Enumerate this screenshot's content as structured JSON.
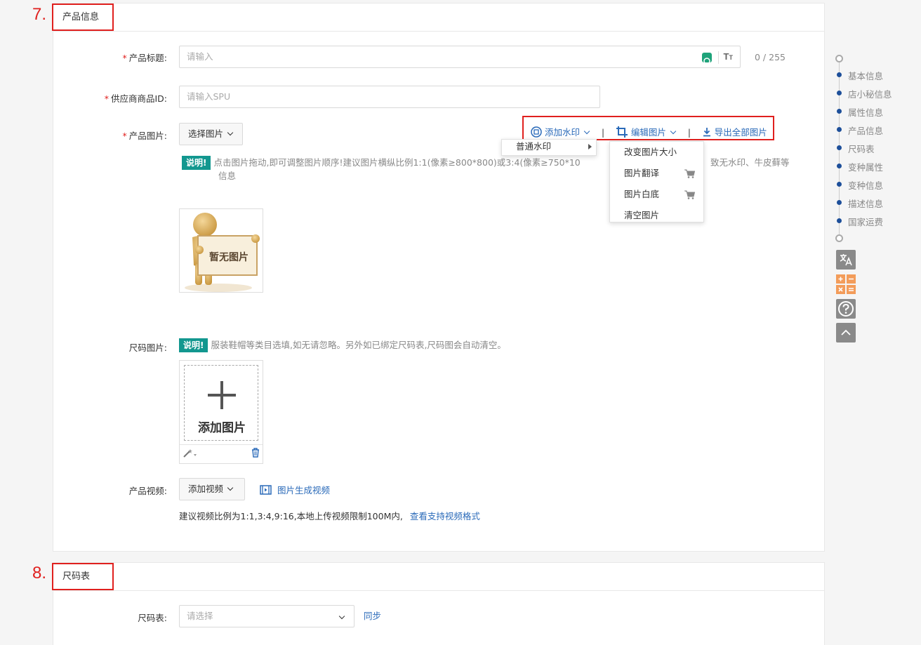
{
  "annotations": {
    "step7": "7.",
    "step8": "8."
  },
  "product_section": {
    "title": "产品信息",
    "title_field": {
      "label": "产品标题:",
      "placeholder": "请输入",
      "counter": "0 / 255"
    },
    "spu_field": {
      "label": "供应商商品ID:",
      "placeholder": "请输入SPU"
    },
    "images": {
      "label": "产品图片:",
      "select_button": "选择图片",
      "note_badge": "说明!",
      "note_text": "点击图片拖动,即可调整图片顺序!建议图片横纵比例1:1(像素≥800*800)或3:4(像素≥750*10",
      "note_tail": "致无水印、牛皮藓等",
      "note_line2": "信息",
      "placeholder_image_text": "暂无图片",
      "toolbar": {
        "watermark": "添加水印",
        "separator": "|",
        "edit": "编辑图片",
        "export": "导出全部图片"
      },
      "watermark_menu": [
        "普通水印"
      ],
      "edit_menu": [
        "改变图片大小",
        "图片翻译",
        "图片白底",
        "清空图片"
      ]
    },
    "size_chart_image": {
      "label": "尺码图片:",
      "note_badge": "说明!",
      "note_text": "服装鞋帽等类目选填,如无请忽略。另外如已绑定尺码表,尺码图会自动清空。",
      "add_text": "添加图片"
    },
    "video": {
      "label": "产品视频:",
      "add_button": "添加视频",
      "generate_link": "图片生成视频",
      "hint": "建议视频比例为1:1,3:4,9:16,本地上传视频限制100M内,",
      "formats_link": "查看支持视频格式"
    }
  },
  "size_section": {
    "title": "尺码表",
    "label": "尺码表:",
    "placeholder": "请选择",
    "sync_link": "同步"
  },
  "side_nav": [
    "基本信息",
    "店小秘信息",
    "属性信息",
    "产品信息",
    "尺码表",
    "变种属性",
    "变种信息",
    "描述信息",
    "国家运费"
  ],
  "colors": {
    "accent_red": "#e0201e",
    "link_blue": "#2a6ab9",
    "badge_teal": "#12978f",
    "nav_dot": "#1d4f9a",
    "calc_orange": "#f39c5a"
  }
}
